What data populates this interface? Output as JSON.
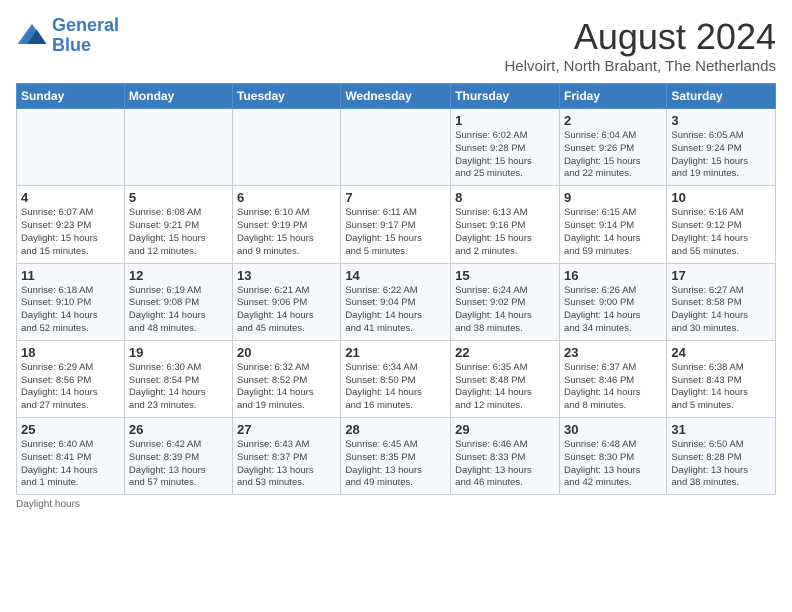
{
  "logo": {
    "line1": "General",
    "line2": "Blue"
  },
  "title": "August 2024",
  "subtitle": "Helvoirt, North Brabant, The Netherlands",
  "days_of_week": [
    "Sunday",
    "Monday",
    "Tuesday",
    "Wednesday",
    "Thursday",
    "Friday",
    "Saturday"
  ],
  "weeks": [
    [
      {
        "day": "",
        "info": ""
      },
      {
        "day": "",
        "info": ""
      },
      {
        "day": "",
        "info": ""
      },
      {
        "day": "",
        "info": ""
      },
      {
        "day": "1",
        "info": "Sunrise: 6:02 AM\nSunset: 9:28 PM\nDaylight: 15 hours\nand 25 minutes."
      },
      {
        "day": "2",
        "info": "Sunrise: 6:04 AM\nSunset: 9:26 PM\nDaylight: 15 hours\nand 22 minutes."
      },
      {
        "day": "3",
        "info": "Sunrise: 6:05 AM\nSunset: 9:24 PM\nDaylight: 15 hours\nand 19 minutes."
      }
    ],
    [
      {
        "day": "4",
        "info": "Sunrise: 6:07 AM\nSunset: 9:23 PM\nDaylight: 15 hours\nand 15 minutes."
      },
      {
        "day": "5",
        "info": "Sunrise: 6:08 AM\nSunset: 9:21 PM\nDaylight: 15 hours\nand 12 minutes."
      },
      {
        "day": "6",
        "info": "Sunrise: 6:10 AM\nSunset: 9:19 PM\nDaylight: 15 hours\nand 9 minutes."
      },
      {
        "day": "7",
        "info": "Sunrise: 6:11 AM\nSunset: 9:17 PM\nDaylight: 15 hours\nand 5 minutes."
      },
      {
        "day": "8",
        "info": "Sunrise: 6:13 AM\nSunset: 9:16 PM\nDaylight: 15 hours\nand 2 minutes."
      },
      {
        "day": "9",
        "info": "Sunrise: 6:15 AM\nSunset: 9:14 PM\nDaylight: 14 hours\nand 59 minutes."
      },
      {
        "day": "10",
        "info": "Sunrise: 6:16 AM\nSunset: 9:12 PM\nDaylight: 14 hours\nand 55 minutes."
      }
    ],
    [
      {
        "day": "11",
        "info": "Sunrise: 6:18 AM\nSunset: 9:10 PM\nDaylight: 14 hours\nand 52 minutes."
      },
      {
        "day": "12",
        "info": "Sunrise: 6:19 AM\nSunset: 9:08 PM\nDaylight: 14 hours\nand 48 minutes."
      },
      {
        "day": "13",
        "info": "Sunrise: 6:21 AM\nSunset: 9:06 PM\nDaylight: 14 hours\nand 45 minutes."
      },
      {
        "day": "14",
        "info": "Sunrise: 6:22 AM\nSunset: 9:04 PM\nDaylight: 14 hours\nand 41 minutes."
      },
      {
        "day": "15",
        "info": "Sunrise: 6:24 AM\nSunset: 9:02 PM\nDaylight: 14 hours\nand 38 minutes."
      },
      {
        "day": "16",
        "info": "Sunrise: 6:26 AM\nSunset: 9:00 PM\nDaylight: 14 hours\nand 34 minutes."
      },
      {
        "day": "17",
        "info": "Sunrise: 6:27 AM\nSunset: 8:58 PM\nDaylight: 14 hours\nand 30 minutes."
      }
    ],
    [
      {
        "day": "18",
        "info": "Sunrise: 6:29 AM\nSunset: 8:56 PM\nDaylight: 14 hours\nand 27 minutes."
      },
      {
        "day": "19",
        "info": "Sunrise: 6:30 AM\nSunset: 8:54 PM\nDaylight: 14 hours\nand 23 minutes."
      },
      {
        "day": "20",
        "info": "Sunrise: 6:32 AM\nSunset: 8:52 PM\nDaylight: 14 hours\nand 19 minutes."
      },
      {
        "day": "21",
        "info": "Sunrise: 6:34 AM\nSunset: 8:50 PM\nDaylight: 14 hours\nand 16 minutes."
      },
      {
        "day": "22",
        "info": "Sunrise: 6:35 AM\nSunset: 8:48 PM\nDaylight: 14 hours\nand 12 minutes."
      },
      {
        "day": "23",
        "info": "Sunrise: 6:37 AM\nSunset: 8:46 PM\nDaylight: 14 hours\nand 8 minutes."
      },
      {
        "day": "24",
        "info": "Sunrise: 6:38 AM\nSunset: 8:43 PM\nDaylight: 14 hours\nand 5 minutes."
      }
    ],
    [
      {
        "day": "25",
        "info": "Sunrise: 6:40 AM\nSunset: 8:41 PM\nDaylight: 14 hours\nand 1 minute."
      },
      {
        "day": "26",
        "info": "Sunrise: 6:42 AM\nSunset: 8:39 PM\nDaylight: 13 hours\nand 57 minutes."
      },
      {
        "day": "27",
        "info": "Sunrise: 6:43 AM\nSunset: 8:37 PM\nDaylight: 13 hours\nand 53 minutes."
      },
      {
        "day": "28",
        "info": "Sunrise: 6:45 AM\nSunset: 8:35 PM\nDaylight: 13 hours\nand 49 minutes."
      },
      {
        "day": "29",
        "info": "Sunrise: 6:46 AM\nSunset: 8:33 PM\nDaylight: 13 hours\nand 46 minutes."
      },
      {
        "day": "30",
        "info": "Sunrise: 6:48 AM\nSunset: 8:30 PM\nDaylight: 13 hours\nand 42 minutes."
      },
      {
        "day": "31",
        "info": "Sunrise: 6:50 AM\nSunset: 8:28 PM\nDaylight: 13 hours\nand 38 minutes."
      }
    ]
  ],
  "footer": "Daylight hours"
}
